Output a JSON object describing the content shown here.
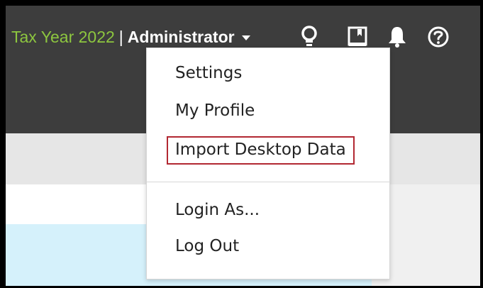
{
  "header": {
    "tax_year": "Tax Year 2022",
    "separator": "|",
    "role": "Administrator",
    "icons": [
      "lightbulb-icon",
      "book-icon",
      "bell-icon",
      "help-icon"
    ],
    "colors": {
      "tax_year": "#8dc63f",
      "background": "#3d3d3d"
    }
  },
  "user_menu": {
    "items": [
      {
        "label": "Settings"
      },
      {
        "label": "My Profile"
      },
      {
        "label": "Import Desktop Data",
        "highlighted": true
      },
      {
        "label": "Login As..."
      },
      {
        "label": "Log Out"
      }
    ],
    "highlight_color": "#b22832"
  }
}
